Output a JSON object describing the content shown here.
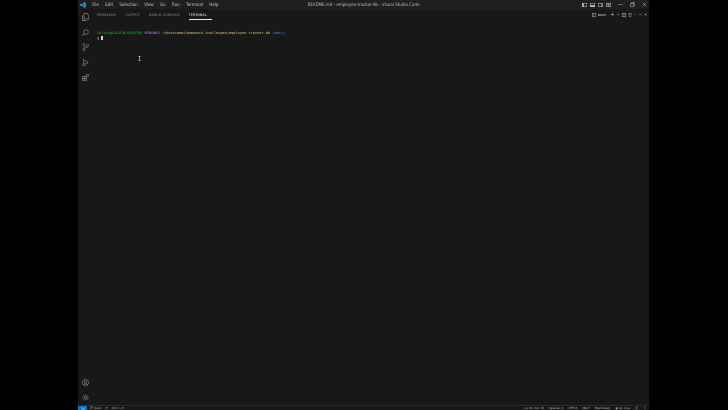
{
  "titlebar": {
    "title": "README.md - employee-tracker-db - Visual Studio Code",
    "menu": [
      "File",
      "Edit",
      "Selection",
      "View",
      "Go",
      "Run",
      "Terminal",
      "Help"
    ]
  },
  "panel": {
    "tabs": [
      "PROBLEMS",
      "OUTPUT",
      "DEBUG CONSOLE",
      "TERMINAL"
    ],
    "active_tab": "TERMINAL",
    "terminal_name": "bash",
    "add_symbol": "+",
    "more_symbol": "···"
  },
  "terminal": {
    "user": "Calvin@CALVIN-DESKTOP",
    "env": "MINGW64",
    "path": "~/bootcamp/homework-challenges/employee-tracker-db",
    "branch": "(main)",
    "prompt": "$"
  },
  "statusbar": {
    "branch": "main",
    "problems": "⊗ 0 ⚠ 0",
    "cursor": "Ln 21, Col 16",
    "spaces": "Spaces: 4",
    "encoding": "UTF-8",
    "eol": "CRLF",
    "language": "Markdown",
    "golive": "Go Live"
  },
  "colors": {
    "accent": "#0078d4",
    "user": "#16c60c",
    "path": "#e5c07b",
    "branch": "#3b8eea"
  }
}
